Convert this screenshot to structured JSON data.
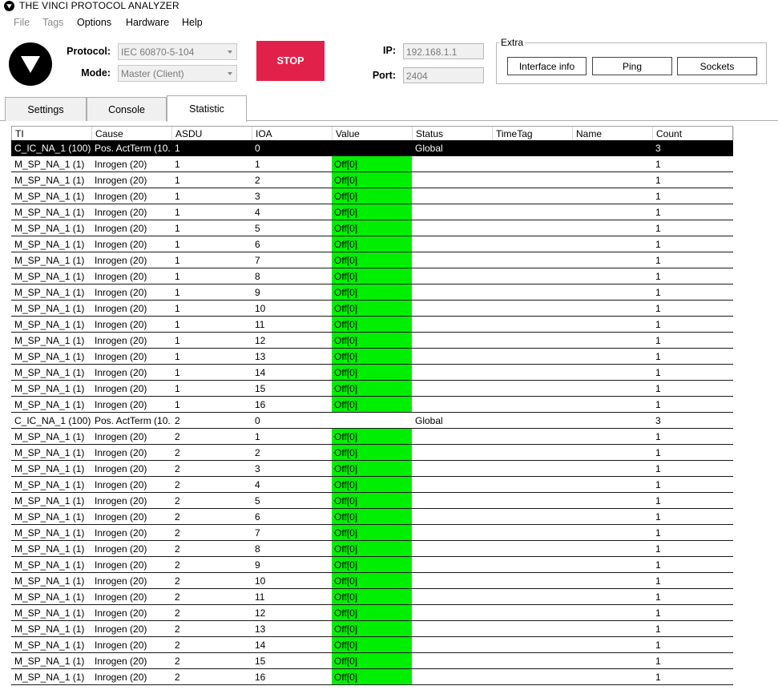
{
  "window": {
    "title": "THE VINCI PROTOCOL ANALYZER"
  },
  "menu": [
    {
      "label": "File",
      "enabled": false
    },
    {
      "label": "Tags",
      "enabled": false
    },
    {
      "label": "Options",
      "enabled": true
    },
    {
      "label": "Hardware",
      "enabled": true
    },
    {
      "label": "Help",
      "enabled": true
    }
  ],
  "connection": {
    "protocol_label": "Protocol:",
    "protocol_value": "IEC 60870-5-104",
    "mode_label": "Mode:",
    "mode_value": "Master (Client)",
    "stop_label": "STOP",
    "ip_label": "IP:",
    "ip_value": "192.168.1.1",
    "port_label": "Port:",
    "port_value": "2404"
  },
  "extra": {
    "legend": "Extra",
    "interface_info": "Interface info",
    "ping": "Ping",
    "sockets": "Sockets"
  },
  "tabs": [
    {
      "label": "Settings",
      "active": false
    },
    {
      "label": "Console",
      "active": false
    },
    {
      "label": "Statistic",
      "active": true
    }
  ],
  "colors": {
    "stop": "#e2214b",
    "value_on": "#00ee00",
    "selected_row": "#000000"
  },
  "grid": {
    "columns": [
      "TI",
      "Cause",
      "ASDU",
      "IOA",
      "Value",
      "Status",
      "TimeTag",
      "Name",
      "Count"
    ],
    "rows": [
      [
        "C_IC_NA_1 (100)",
        "Pos. ActTerm (10...",
        "1",
        "0",
        "",
        "Global",
        "",
        "",
        "3"
      ],
      [
        "M_SP_NA_1 (1)",
        "Inrogen (20)",
        "1",
        "1",
        "Off[0]",
        "",
        "",
        "",
        "1"
      ],
      [
        "M_SP_NA_1 (1)",
        "Inrogen (20)",
        "1",
        "2",
        "Off[0]",
        "",
        "",
        "",
        "1"
      ],
      [
        "M_SP_NA_1 (1)",
        "Inrogen (20)",
        "1",
        "3",
        "Off[0]",
        "",
        "",
        "",
        "1"
      ],
      [
        "M_SP_NA_1 (1)",
        "Inrogen (20)",
        "1",
        "4",
        "Off[0]",
        "",
        "",
        "",
        "1"
      ],
      [
        "M_SP_NA_1 (1)",
        "Inrogen (20)",
        "1",
        "5",
        "Off[0]",
        "",
        "",
        "",
        "1"
      ],
      [
        "M_SP_NA_1 (1)",
        "Inrogen (20)",
        "1",
        "6",
        "Off[0]",
        "",
        "",
        "",
        "1"
      ],
      [
        "M_SP_NA_1 (1)",
        "Inrogen (20)",
        "1",
        "7",
        "Off[0]",
        "",
        "",
        "",
        "1"
      ],
      [
        "M_SP_NA_1 (1)",
        "Inrogen (20)",
        "1",
        "8",
        "Off[0]",
        "",
        "",
        "",
        "1"
      ],
      [
        "M_SP_NA_1 (1)",
        "Inrogen (20)",
        "1",
        "9",
        "Off[0]",
        "",
        "",
        "",
        "1"
      ],
      [
        "M_SP_NA_1 (1)",
        "Inrogen (20)",
        "1",
        "10",
        "Off[0]",
        "",
        "",
        "",
        "1"
      ],
      [
        "M_SP_NA_1 (1)",
        "Inrogen (20)",
        "1",
        "11",
        "Off[0]",
        "",
        "",
        "",
        "1"
      ],
      [
        "M_SP_NA_1 (1)",
        "Inrogen (20)",
        "1",
        "12",
        "Off[0]",
        "",
        "",
        "",
        "1"
      ],
      [
        "M_SP_NA_1 (1)",
        "Inrogen (20)",
        "1",
        "13",
        "Off[0]",
        "",
        "",
        "",
        "1"
      ],
      [
        "M_SP_NA_1 (1)",
        "Inrogen (20)",
        "1",
        "14",
        "Off[0]",
        "",
        "",
        "",
        "1"
      ],
      [
        "M_SP_NA_1 (1)",
        "Inrogen (20)",
        "1",
        "15",
        "Off[0]",
        "",
        "",
        "",
        "1"
      ],
      [
        "M_SP_NA_1 (1)",
        "Inrogen (20)",
        "1",
        "16",
        "Off[0]",
        "",
        "",
        "",
        "1"
      ],
      [
        "C_IC_NA_1 (100)",
        "Pos. ActTerm (10...",
        "2",
        "0",
        "",
        "Global",
        "",
        "",
        "3"
      ],
      [
        "M_SP_NA_1 (1)",
        "Inrogen (20)",
        "2",
        "1",
        "Off[0]",
        "",
        "",
        "",
        "1"
      ],
      [
        "M_SP_NA_1 (1)",
        "Inrogen (20)",
        "2",
        "2",
        "Off[0]",
        "",
        "",
        "",
        "1"
      ],
      [
        "M_SP_NA_1 (1)",
        "Inrogen (20)",
        "2",
        "3",
        "Off[0]",
        "",
        "",
        "",
        "1"
      ],
      [
        "M_SP_NA_1 (1)",
        "Inrogen (20)",
        "2",
        "4",
        "Off[0]",
        "",
        "",
        "",
        "1"
      ],
      [
        "M_SP_NA_1 (1)",
        "Inrogen (20)",
        "2",
        "5",
        "Off[0]",
        "",
        "",
        "",
        "1"
      ],
      [
        "M_SP_NA_1 (1)",
        "Inrogen (20)",
        "2",
        "6",
        "Off[0]",
        "",
        "",
        "",
        "1"
      ],
      [
        "M_SP_NA_1 (1)",
        "Inrogen (20)",
        "2",
        "7",
        "Off[0]",
        "",
        "",
        "",
        "1"
      ],
      [
        "M_SP_NA_1 (1)",
        "Inrogen (20)",
        "2",
        "8",
        "Off[0]",
        "",
        "",
        "",
        "1"
      ],
      [
        "M_SP_NA_1 (1)",
        "Inrogen (20)",
        "2",
        "9",
        "Off[0]",
        "",
        "",
        "",
        "1"
      ],
      [
        "M_SP_NA_1 (1)",
        "Inrogen (20)",
        "2",
        "10",
        "Off[0]",
        "",
        "",
        "",
        "1"
      ],
      [
        "M_SP_NA_1 (1)",
        "Inrogen (20)",
        "2",
        "11",
        "Off[0]",
        "",
        "",
        "",
        "1"
      ],
      [
        "M_SP_NA_1 (1)",
        "Inrogen (20)",
        "2",
        "12",
        "Off[0]",
        "",
        "",
        "",
        "1"
      ],
      [
        "M_SP_NA_1 (1)",
        "Inrogen (20)",
        "2",
        "13",
        "Off[0]",
        "",
        "",
        "",
        "1"
      ],
      [
        "M_SP_NA_1 (1)",
        "Inrogen (20)",
        "2",
        "14",
        "Off[0]",
        "",
        "",
        "",
        "1"
      ],
      [
        "M_SP_NA_1 (1)",
        "Inrogen (20)",
        "2",
        "15",
        "Off[0]",
        "",
        "",
        "",
        "1"
      ],
      [
        "M_SP_NA_1 (1)",
        "Inrogen (20)",
        "2",
        "16",
        "Off[0]",
        "",
        "",
        "",
        "1"
      ]
    ],
    "selected_row_index": 0
  }
}
